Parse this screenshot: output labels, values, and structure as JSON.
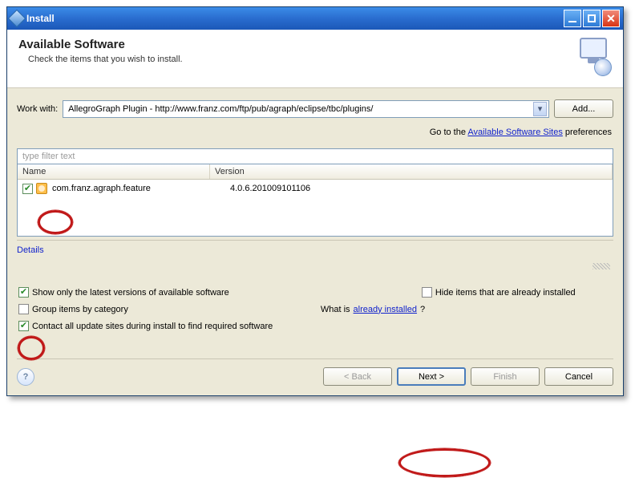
{
  "window": {
    "title": "Install"
  },
  "header": {
    "heading": "Available Software",
    "subtext": "Check the items that you wish to install."
  },
  "work": {
    "label": "Work with:",
    "value": "AllegroGraph Plugin - http://www.franz.com/ftp/pub/agraph/eclipse/tbc/plugins/",
    "add_label": "Add..."
  },
  "goto": {
    "prefix": "Go to the ",
    "link": "Available Software Sites",
    "suffix": " preferences"
  },
  "filter": {
    "placeholder": "type filter text"
  },
  "columns": {
    "name": "Name",
    "version": "Version"
  },
  "rows": [
    {
      "checked": true,
      "name": "com.franz.agraph.feature",
      "version": "4.0.6.201009101106"
    }
  ],
  "details": {
    "title": "Details"
  },
  "options": {
    "show_latest": {
      "checked": true,
      "label": "Show only the latest versions of available software"
    },
    "hide_installed": {
      "checked": false,
      "label": "Hide items that are already installed"
    },
    "group_category": {
      "checked": false,
      "label": "Group items by category"
    },
    "already_prefix": "What is ",
    "already_link": "already installed",
    "already_suffix": "?",
    "contact_all": {
      "checked": true,
      "label": "Contact all update sites during install to find required software"
    }
  },
  "buttons": {
    "back": "< Back",
    "next": "Next >",
    "finish": "Finish",
    "cancel": "Cancel"
  }
}
